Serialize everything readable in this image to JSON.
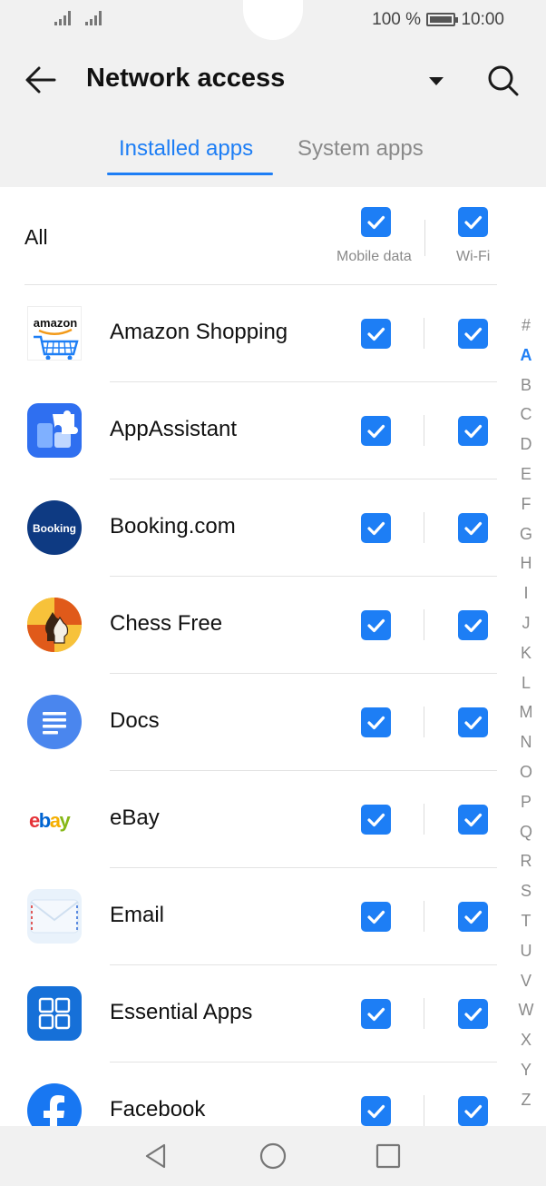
{
  "status_bar": {
    "battery": "100 %",
    "time": "10:00"
  },
  "header": {
    "title": "Network access",
    "back_icon": "arrow-left-icon",
    "dropdown_icon": "caret-down-icon",
    "search_icon": "search-icon"
  },
  "tabs": [
    {
      "label": "Installed apps",
      "active": true
    },
    {
      "label": "System apps",
      "active": false
    }
  ],
  "all_row": {
    "label": "All",
    "mobile_label": "Mobile data",
    "wifi_label": "Wi-Fi",
    "mobile_checked": true,
    "wifi_checked": true
  },
  "apps": [
    {
      "name": "Amazon Shopping",
      "icon": "amazon-icon",
      "mobile": true,
      "wifi": true
    },
    {
      "name": "AppAssistant",
      "icon": "puzzle-icon",
      "mobile": true,
      "wifi": true
    },
    {
      "name": "Booking.com",
      "icon": "booking-icon",
      "icon_text": "Booking",
      "mobile": true,
      "wifi": true
    },
    {
      "name": "Chess Free",
      "icon": "chess-knight-icon",
      "mobile": true,
      "wifi": true
    },
    {
      "name": "Docs",
      "icon": "docs-icon",
      "mobile": true,
      "wifi": true
    },
    {
      "name": "eBay",
      "icon": "ebay-icon",
      "mobile": true,
      "wifi": true
    },
    {
      "name": "Email",
      "icon": "envelope-icon",
      "mobile": true,
      "wifi": true
    },
    {
      "name": "Essential Apps",
      "icon": "grid-apps-icon",
      "mobile": true,
      "wifi": true
    },
    {
      "name": "Facebook",
      "icon": "facebook-icon",
      "mobile": true,
      "wifi": true
    }
  ],
  "amazon_logo_text": "amazon",
  "ebay_letters": [
    "e",
    "b",
    "a",
    "y"
  ],
  "alphabet": [
    "#",
    "A",
    "B",
    "C",
    "D",
    "E",
    "F",
    "G",
    "H",
    "I",
    "J",
    "K",
    "L",
    "M",
    "N",
    "O",
    "P",
    "Q",
    "R",
    "S",
    "T",
    "U",
    "V",
    "W",
    "X",
    "Y",
    "Z"
  ],
  "alphabet_active": "A",
  "colors": {
    "accent": "#1d7ef5",
    "header_bg": "#f1f1f1",
    "content_bg": "#ffffff"
  },
  "nav": {
    "back": "triangle-back-icon",
    "home": "circle-home-icon",
    "recents": "square-recents-icon"
  }
}
